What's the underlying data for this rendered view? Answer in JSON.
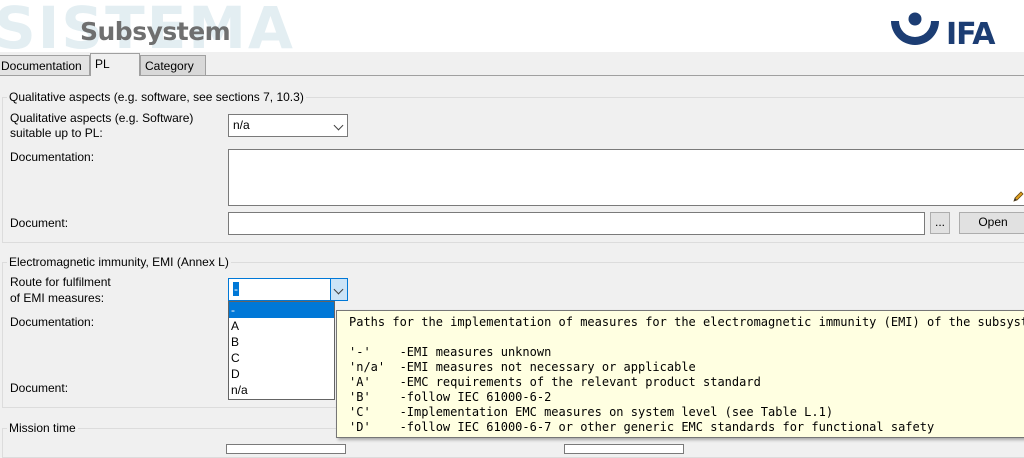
{
  "header": {
    "watermark": "SISTEMA",
    "title": "Subsystem",
    "logo_text": "IFA"
  },
  "tabs": [
    {
      "label": "Documentation"
    },
    {
      "label": "PL"
    },
    {
      "label": "Category"
    }
  ],
  "qualitative": {
    "group_title": "Qualitative aspects (e.g. software, see sections 7, 10.3)",
    "pl_label_line1": "Qualitative aspects (e.g. Software)",
    "pl_label_line2": "suitable up to PL:",
    "pl_value": "n/a",
    "documentation_label": "Documentation:",
    "document_label": "Document:",
    "browse_label": "...",
    "open_label": "Open"
  },
  "emi": {
    "group_title": "Electromagnetic immunity, EMI (Annex L)",
    "route_label_line1": "Route for fulfilment",
    "route_label_line2": "of EMI measures:",
    "route_value": "-",
    "documentation_label": "Documentation:",
    "document_label": "Document:",
    "options": [
      "-",
      "A",
      "B",
      "C",
      "D",
      "n/a"
    ],
    "selected_index": 0
  },
  "mission": {
    "group_title": "Mission time"
  },
  "tooltip": {
    "lines": [
      "Paths for the implementation of measures for the electromagnetic immunity (EMI) of the subsystem",
      "",
      "'-'    -EMI measures unknown",
      "'n/a'  -EMI measures not necessary or applicable",
      "'A'    -EMC requirements of the relevant product standard",
      "'B'    -follow IEC 61000-6-2",
      "'C'    -Implementation EMC measures on system level (see Table L.1)",
      "'D'    -follow IEC 61000-6-7 or other generic EMC standards for functional safety"
    ]
  },
  "colors": {
    "accent": "#0078d7",
    "logo_blue": "#1c3d73",
    "tooltip_bg": "#ffffe1"
  }
}
